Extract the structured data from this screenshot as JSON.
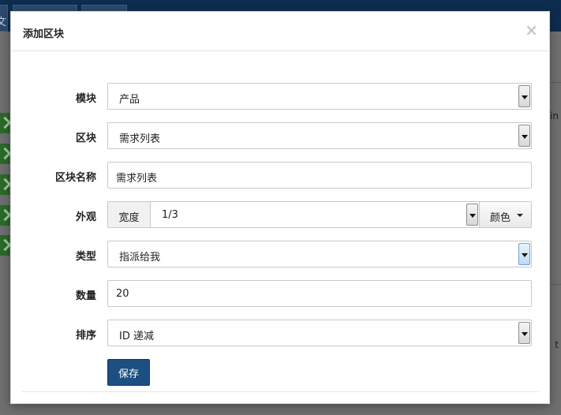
{
  "background": {
    "tab_glyph": "文",
    "right_text_1": "in",
    "right_text_2": "t"
  },
  "dialog": {
    "title": "添加区块",
    "close_symbol": "×"
  },
  "form": {
    "module": {
      "label": "模块",
      "value": "产品"
    },
    "block": {
      "label": "区块",
      "value": "需求列表"
    },
    "block_name": {
      "label": "区块名称",
      "value": "需求列表"
    },
    "appearance": {
      "label": "外观",
      "width_label": "宽度",
      "width_value": "1/3",
      "color_button": "颜色"
    },
    "type": {
      "label": "类型",
      "value": "指派给我"
    },
    "count": {
      "label": "数量",
      "value": "20"
    },
    "order": {
      "label": "排序",
      "value": "ID 递减"
    },
    "save_label": "保存"
  },
  "colors": {
    "primary": "#1c4f82",
    "topbar": "#0d2d4f",
    "side_button": "#2c6a29"
  }
}
